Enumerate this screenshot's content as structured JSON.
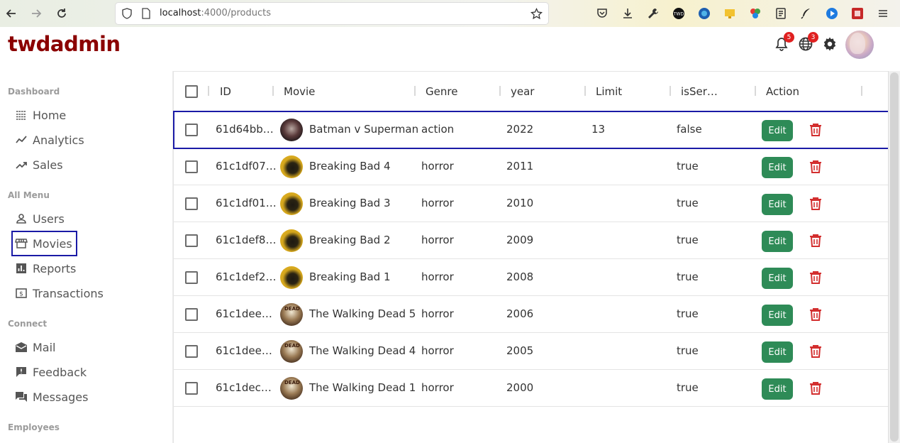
{
  "browser": {
    "url_host": "localhost",
    "url_path": ":4000/products"
  },
  "app": {
    "logo": "twdadmin",
    "notifications_count": "5",
    "language_count": "3"
  },
  "sidebar": {
    "sections": [
      {
        "title": "Dashboard",
        "items": [
          "Home",
          "Analytics",
          "Sales"
        ]
      },
      {
        "title": "All Menu",
        "items": [
          "Users",
          "Movies",
          "Reports",
          "Transactions"
        ]
      },
      {
        "title": "Connect",
        "items": [
          "Mail",
          "Feedback",
          "Messages"
        ]
      },
      {
        "title": "Employees",
        "items": []
      }
    ],
    "selected": "Movies"
  },
  "table": {
    "columns": [
      "ID",
      "Movie",
      "Genre",
      "year",
      "Limit",
      "isSer…",
      "Action"
    ],
    "edit_label": "Edit",
    "rows": [
      {
        "id": "61d64bb…",
        "movie": "Batman v Superman",
        "genre": "action",
        "year": "2022",
        "limit": "13",
        "isSeries": "false",
        "thumb": "batman"
      },
      {
        "id": "61c1df07…",
        "movie": "Breaking Bad 4",
        "genre": "horror",
        "year": "2011",
        "limit": "",
        "isSeries": "true",
        "thumb": "bb"
      },
      {
        "id": "61c1df01…",
        "movie": "Breaking Bad 3",
        "genre": "horror",
        "year": "2010",
        "limit": "",
        "isSeries": "true",
        "thumb": "bb"
      },
      {
        "id": "61c1def8…",
        "movie": "Breaking Bad 2",
        "genre": "horror",
        "year": "2009",
        "limit": "",
        "isSeries": "true",
        "thumb": "bb"
      },
      {
        "id": "61c1def2…",
        "movie": "Breaking Bad 1",
        "genre": "horror",
        "year": "2008",
        "limit": "",
        "isSeries": "true",
        "thumb": "bb"
      },
      {
        "id": "61c1dee…",
        "movie": "The Walking Dead 5",
        "genre": "horror",
        "year": "2006",
        "limit": "",
        "isSeries": "true",
        "thumb": "wd"
      },
      {
        "id": "61c1dee…",
        "movie": "The Walking Dead 4",
        "genre": "horror",
        "year": "2005",
        "limit": "",
        "isSeries": "true",
        "thumb": "wd"
      },
      {
        "id": "61c1dec…",
        "movie": "The Walking Dead 1",
        "genre": "horror",
        "year": "2000",
        "limit": "",
        "isSeries": "true",
        "thumb": "wd"
      }
    ],
    "highlighted_row": 0
  },
  "colors": {
    "logo": "#8b0000",
    "edit_button": "#2e8b57",
    "delete_icon": "#d32f2f",
    "highlight_outline": "#1a1aa6",
    "badge": "#e02020"
  }
}
